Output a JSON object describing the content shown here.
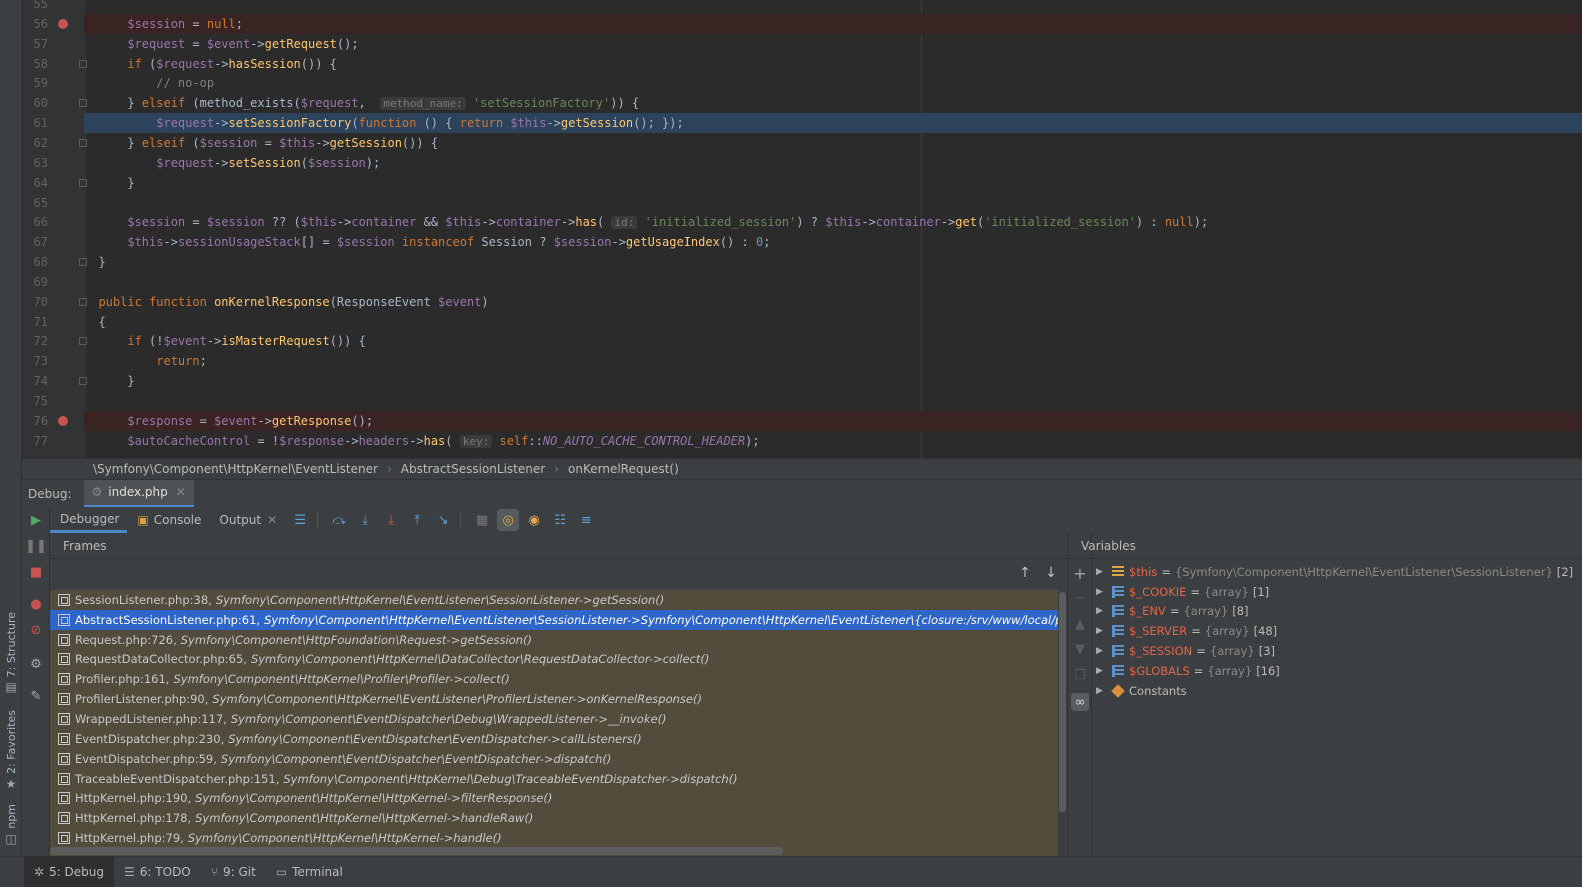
{
  "left_strip": {
    "structure_label": "7: Structure",
    "favorites_label": "2: Favorites",
    "npm_label": "npm"
  },
  "editor": {
    "lines": [
      {
        "num": "55",
        "html": ""
      },
      {
        "num": "56",
        "bp": true,
        "html": "    <span class='v'>$session</span> = <span class='k'>null</span>;"
      },
      {
        "num": "57",
        "html": "    <span class='v'>$request</span> = <span class='v'>$event</span>-&gt;<span class='f'>getRequest</span>();"
      },
      {
        "num": "58",
        "fold": true,
        "html": "    <span class='k'>if</span> (<span class='v'>$request</span>-&gt;<span class='f'>hasSession</span>()) {"
      },
      {
        "num": "59",
        "html": "        <span class='c'>// no-op</span>"
      },
      {
        "num": "60",
        "fold": true,
        "html": "    } <span class='k'>elseif</span> (method_exists(<span class='v'>$request</span>,  <span class='hint'>method_name:</span> <span class='s'>'setSessionFactory'</span>)) {"
      },
      {
        "num": "61",
        "cur": true,
        "html": "        <span class='v'>$request</span>-&gt;<span class='f'>setSessionFactory</span>(<span class='k'>function</span> () { <span class='k'>return</span> <span class='v'>$this</span>-&gt;<span class='f'>getSession</span>(); });"
      },
      {
        "num": "62",
        "fold": true,
        "html": "    } <span class='k'>elseif</span> (<span class='v'>$session</span> = <span class='v'>$this</span>-&gt;<span class='f'>getSession</span>()) {"
      },
      {
        "num": "63",
        "html": "        <span class='v'>$request</span>-&gt;<span class='f'>setSession</span>(<span class='v'>$session</span>);"
      },
      {
        "num": "64",
        "fold": true,
        "html": "    }"
      },
      {
        "num": "65",
        "html": ""
      },
      {
        "num": "66",
        "html": "    <span class='v'>$session</span> = <span class='v'>$session</span> ?? (<span class='v'>$this</span>-&gt;<span class='v'>container</span> &amp;&amp; <span class='v'>$this</span>-&gt;<span class='v'>container</span>-&gt;<span class='f'>has</span>( <span class='hint'>id:</span> <span class='s'>'initialized_session'</span>) ? <span class='v'>$this</span>-&gt;<span class='v'>container</span>-&gt;<span class='f'>get</span>(<span class='s'>'initialized_session'</span>) : <span class='k'>null</span>);"
      },
      {
        "num": "67",
        "html": "    <span class='v'>$this</span>-&gt;<span class='v'>sessionUsageStack</span>[] = <span class='v'>$session</span> <span class='k'>instanceof</span> Session ? <span class='v'>$session</span>-&gt;<span class='f'>getUsageIndex</span>() : <span class='n'>0</span>;"
      },
      {
        "num": "68",
        "fold": true,
        "html": "}"
      },
      {
        "num": "69",
        "html": ""
      },
      {
        "num": "70",
        "fold": true,
        "html": "<span class='k'>public function</span> <span class='f'>onKernelResponse</span>(ResponseEvent <span class='v'>$event</span>)"
      },
      {
        "num": "71",
        "html": "{"
      },
      {
        "num": "72",
        "fold": true,
        "html": "    <span class='k'>if</span> (!<span class='v'>$event</span>-&gt;<span class='f'>isMasterRequest</span>()) {"
      },
      {
        "num": "73",
        "html": "        <span class='k'>return</span>;"
      },
      {
        "num": "74",
        "fold": true,
        "html": "    }"
      },
      {
        "num": "75",
        "html": ""
      },
      {
        "num": "76",
        "bp": true,
        "html": "    <span class='v'>$response</span> = <span class='v'>$event</span>-&gt;<span class='f'>getResponse</span>();"
      },
      {
        "num": "77",
        "html": "    <span class='v'>$autoCacheControl</span> = !<span class='v'>$response</span>-&gt;<span class='v'>headers</span>-&gt;<span class='f'>has</span>( <span class='hint'>key:</span> <span class='k'>self</span>::<span class='cst'>NO_AUTO_CACHE_CONTROL_HEADER</span>);"
      }
    ]
  },
  "breadcrumb": {
    "items": [
      "\\Symfony\\Component\\HttpKernel\\EventListener",
      "AbstractSessionListener",
      "onKernelRequest()"
    ]
  },
  "debug": {
    "label": "Debug:",
    "tab": "index.php"
  },
  "toolbar": {
    "debugger_tab": "Debugger",
    "console_tab": "Console",
    "output_tab": "Output"
  },
  "frames": {
    "title": "Frames",
    "rows": [
      {
        "loc": "SessionListener.php:38,",
        "call": "Symfony\\Component\\HttpKernel\\EventListener\\SessionListener->getSession()"
      },
      {
        "loc": "AbstractSessionListener.php:61,",
        "call": "Symfony\\Component\\HttpKernel\\EventListener\\SessionListener->Symfony\\Component\\HttpKernel\\EventListener\\{closure:/srv/www/local/parsel/vendor/symfony",
        "selected": true
      },
      {
        "loc": "Request.php:726,",
        "call": "Symfony\\Component\\HttpFoundation\\Request->getSession()"
      },
      {
        "loc": "RequestDataCollector.php:65,",
        "call": "Symfony\\Component\\HttpKernel\\DataCollector\\RequestDataCollector->collect()"
      },
      {
        "loc": "Profiler.php:161,",
        "call": "Symfony\\Component\\HttpKernel\\Profiler\\Profiler->collect()"
      },
      {
        "loc": "ProfilerListener.php:90,",
        "call": "Symfony\\Component\\HttpKernel\\EventListener\\ProfilerListener->onKernelResponse()"
      },
      {
        "loc": "WrappedListener.php:117,",
        "call": "Symfony\\Component\\EventDispatcher\\Debug\\WrappedListener->__invoke()"
      },
      {
        "loc": "EventDispatcher.php:230,",
        "call": "Symfony\\Component\\EventDispatcher\\EventDispatcher->callListeners()"
      },
      {
        "loc": "EventDispatcher.php:59,",
        "call": "Symfony\\Component\\EventDispatcher\\EventDispatcher->dispatch()"
      },
      {
        "loc": "TraceableEventDispatcher.php:151,",
        "call": "Symfony\\Component\\HttpKernel\\Debug\\TraceableEventDispatcher->dispatch()"
      },
      {
        "loc": "HttpKernel.php:190,",
        "call": "Symfony\\Component\\HttpKernel\\HttpKernel->filterResponse()"
      },
      {
        "loc": "HttpKernel.php:178,",
        "call": "Symfony\\Component\\HttpKernel\\HttpKernel->handleRaw()"
      },
      {
        "loc": "HttpKernel.php:79,",
        "call": "Symfony\\Component\\HttpKernel\\HttpKernel->handle()"
      }
    ]
  },
  "variables": {
    "title": "Variables",
    "rows": [
      {
        "name": "$this",
        "type": "{Symfony\\Component\\HttpKernel\\EventListener\\SessionListener}",
        "count": "[2]",
        "icon": "object-icon"
      },
      {
        "name": "$_COOKIE",
        "type": "{array}",
        "count": "[1]",
        "icon": "array-icon"
      },
      {
        "name": "$_ENV",
        "type": "{array}",
        "count": "[8]",
        "icon": "array-icon"
      },
      {
        "name": "$_SERVER",
        "type": "{array}",
        "count": "[48]",
        "icon": "array-icon"
      },
      {
        "name": "$_SESSION",
        "type": "{array}",
        "count": "[3]",
        "icon": "array-icon"
      },
      {
        "name": "$GLOBALS",
        "type": "{array}",
        "count": "[16]",
        "icon": "array-icon"
      },
      {
        "name": "Constants",
        "type": "",
        "count": "",
        "icon": "constants-icon",
        "plain": true
      }
    ]
  },
  "statusbar": {
    "debug_tab": "5: Debug",
    "todo_tab": "6: TODO",
    "git_tab": "9: Git",
    "terminal_tab": "Terminal"
  },
  "colors": {
    "accent": "#4a88c7",
    "selection": "#2e65ca",
    "breakpoint": "#c75450"
  }
}
